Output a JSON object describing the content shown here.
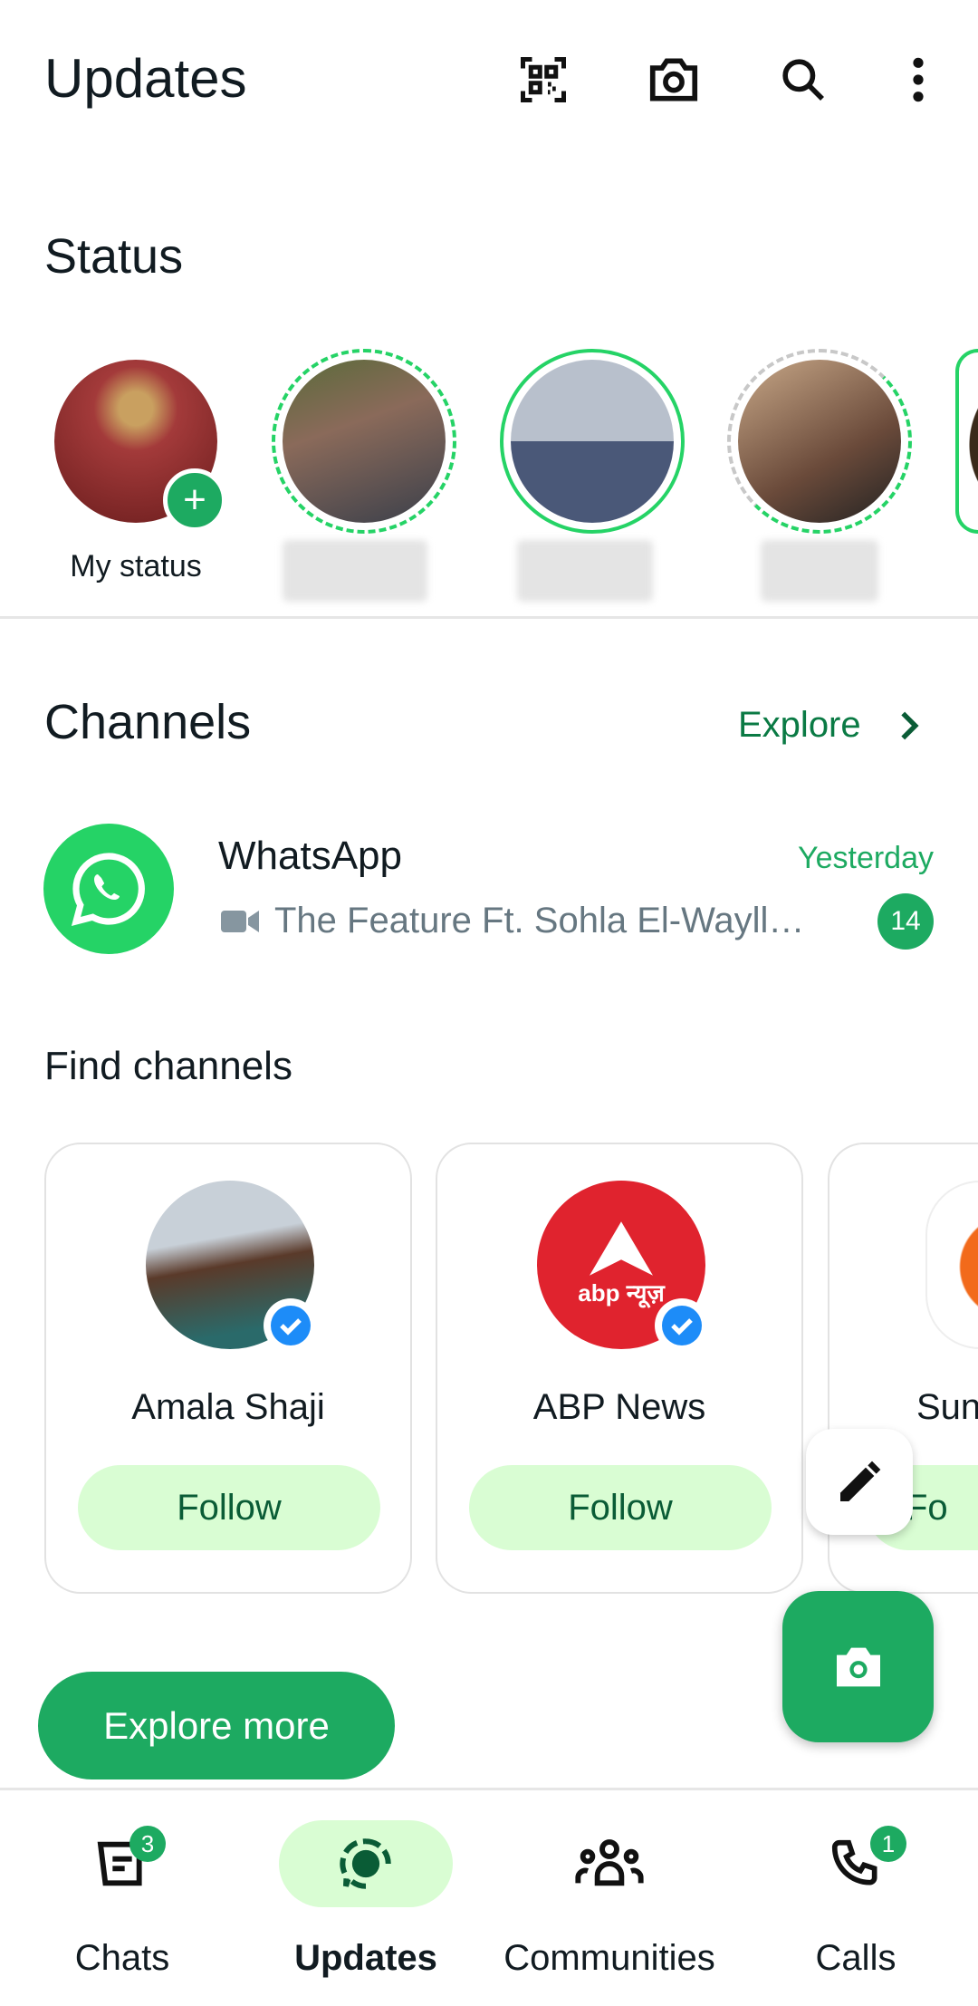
{
  "header": {
    "title": "Updates",
    "icons": [
      "qr-scan-icon",
      "camera-icon",
      "search-icon",
      "more-vert-icon"
    ]
  },
  "status": {
    "heading": "Status",
    "my_status_label": "My status",
    "accent": "#25d366"
  },
  "channels": {
    "heading": "Channels",
    "explore_label": "Explore",
    "items": [
      {
        "name": "WhatsApp",
        "time": "Yesterday",
        "preview": "The Feature Ft. Sohla El-Wayll…",
        "unread": "14"
      }
    ]
  },
  "find_channels": {
    "heading": "Find channels",
    "cards": [
      {
        "name": "Amala Shaji",
        "follow": "Follow"
      },
      {
        "name": "ABP News",
        "follow": "Follow",
        "logo_text": "abp न्यूज़"
      },
      {
        "name": "Sun",
        "follow": "Fo"
      }
    ],
    "explore_more": "Explore more"
  },
  "nav": {
    "items": [
      {
        "label": "Chats",
        "badge": "3"
      },
      {
        "label": "Updates",
        "active": true
      },
      {
        "label": "Communities"
      },
      {
        "label": "Calls",
        "badge": "1"
      }
    ]
  },
  "colors": {
    "brand": "#1daa61",
    "pill": "#d9fdd3",
    "dark_green": "#0a5c36"
  }
}
